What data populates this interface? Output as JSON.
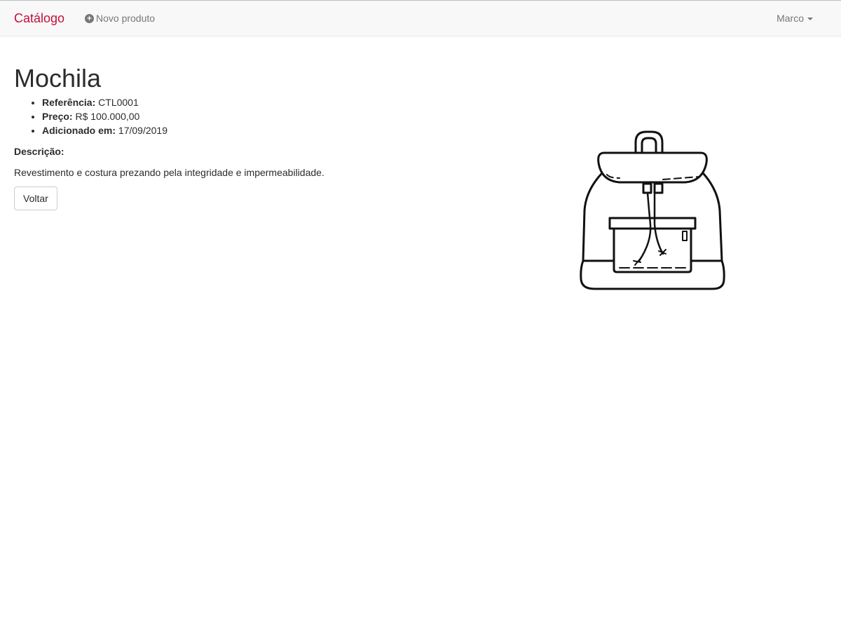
{
  "navbar": {
    "brand": "Catálogo",
    "new_product_label": "Novo produto",
    "new_product_icon": "plus-circle-icon",
    "user_name": "Marco",
    "brand_color": "#c2113a"
  },
  "product": {
    "title": "Mochila",
    "reference_label": "Referência:",
    "reference_value": "CTL0001",
    "price_label": "Preço:",
    "price_value": "R$ 100.000,00",
    "added_label": "Adicionado em:",
    "added_value": "17/09/2019",
    "description_label": "Descrição:",
    "description_text": "Revestimento e costura prezando pela integridade e impermeabilidade.",
    "image_icon": "backpack-icon"
  },
  "actions": {
    "back_label": "Voltar"
  }
}
